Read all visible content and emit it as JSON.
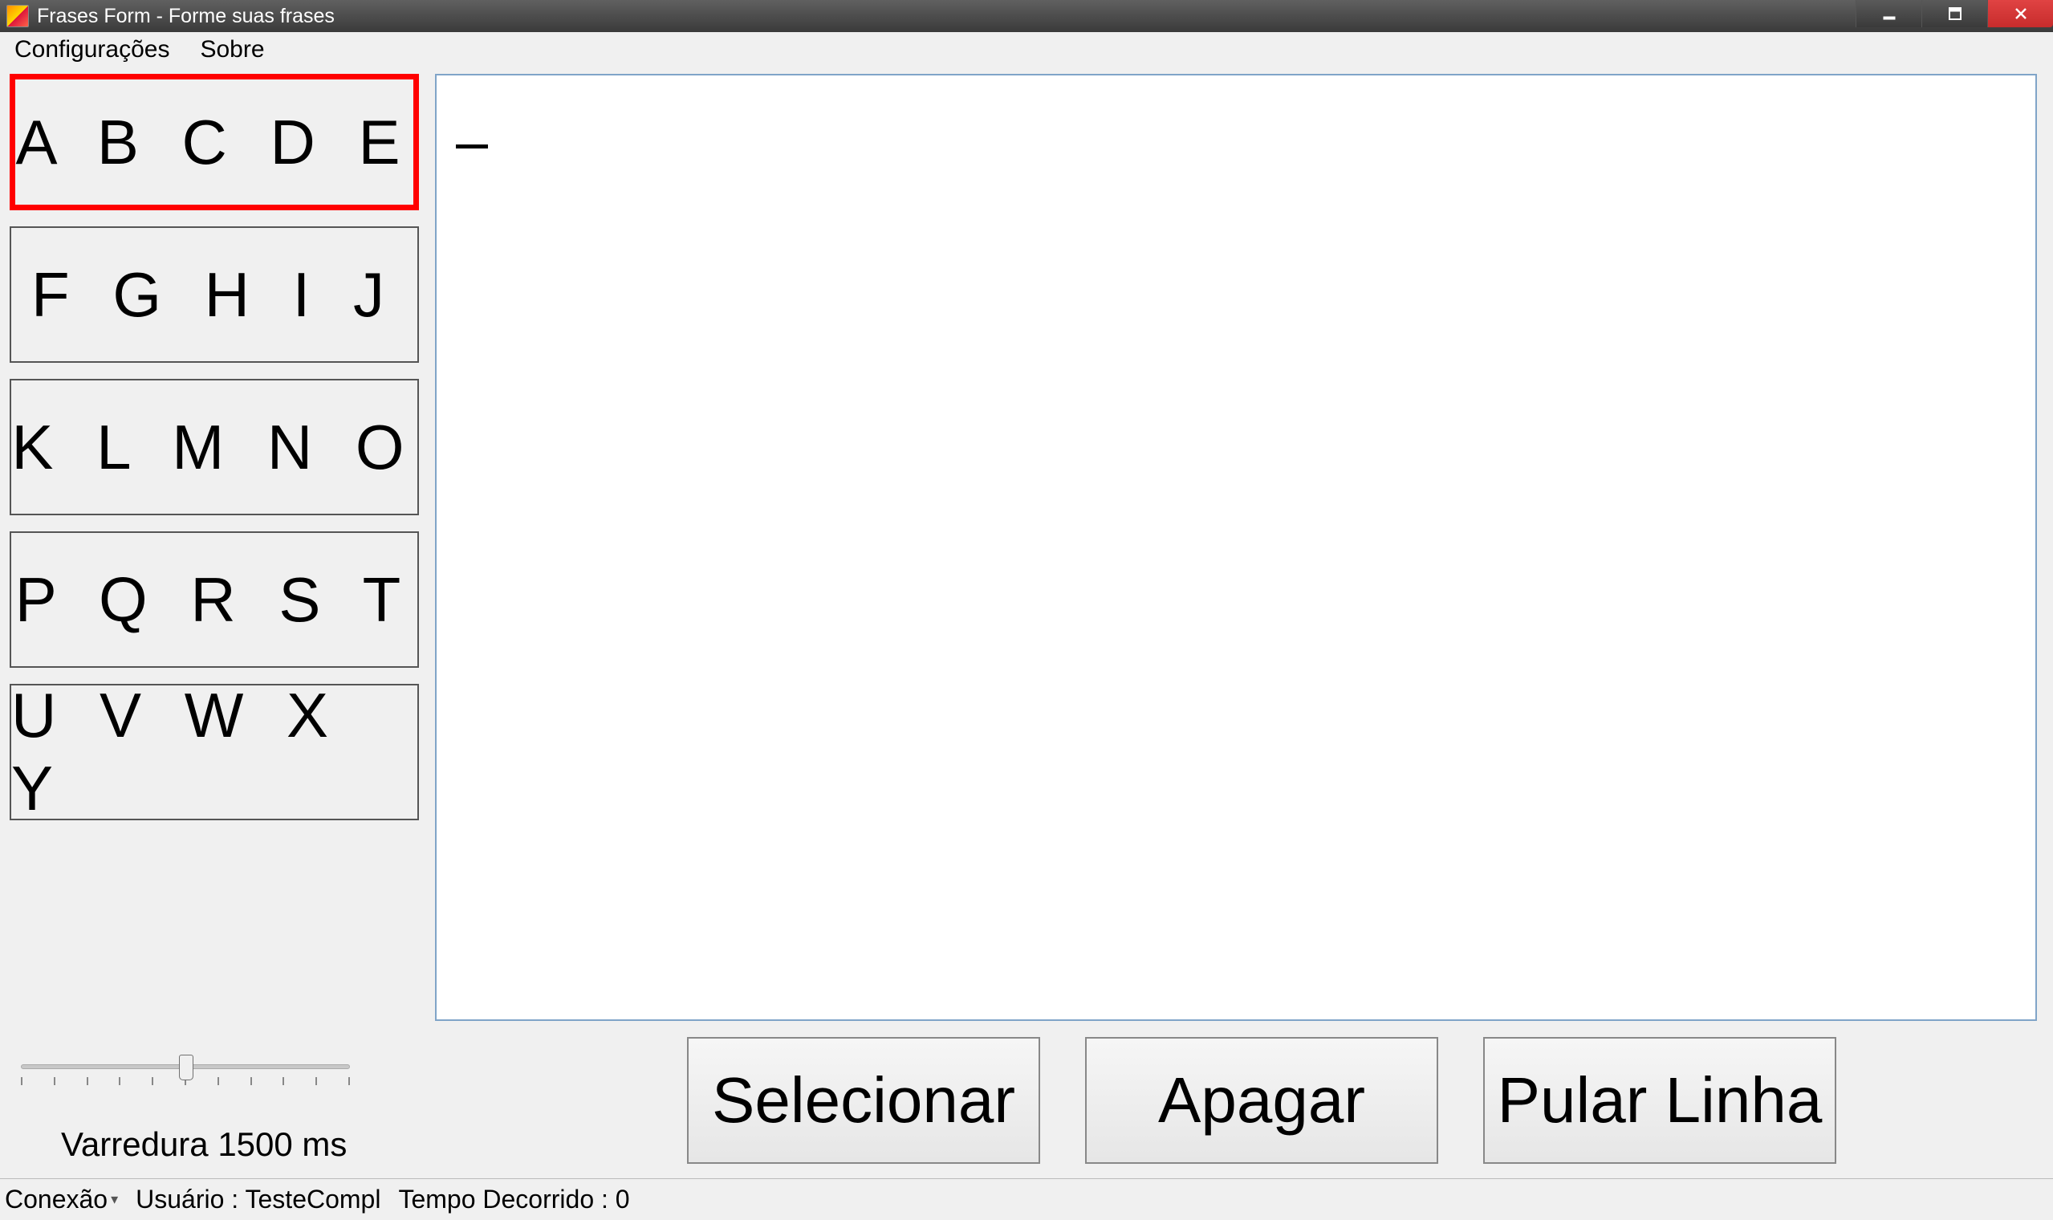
{
  "window": {
    "title": "Frases Form - Forme suas frases"
  },
  "menu": {
    "config": "Configurações",
    "about": "Sobre"
  },
  "letter_groups": [
    {
      "label": "A B C D E",
      "selected": true
    },
    {
      "label": "F G H I J",
      "selected": false
    },
    {
      "label": "K L M N O",
      "selected": false
    },
    {
      "label": "P Q R S T",
      "selected": false
    },
    {
      "label": "U V W X Y",
      "selected": false
    }
  ],
  "output_text": "_",
  "slider": {
    "label": "Varredura 1500 ms",
    "value_ms": 1500
  },
  "buttons": {
    "select": "Selecionar",
    "erase": "Apagar",
    "newline": "Pular Linha"
  },
  "status": {
    "connection": "Conexão",
    "user": "Usuário : TesteCompl",
    "elapsed": "Tempo Decorrido : 0"
  }
}
